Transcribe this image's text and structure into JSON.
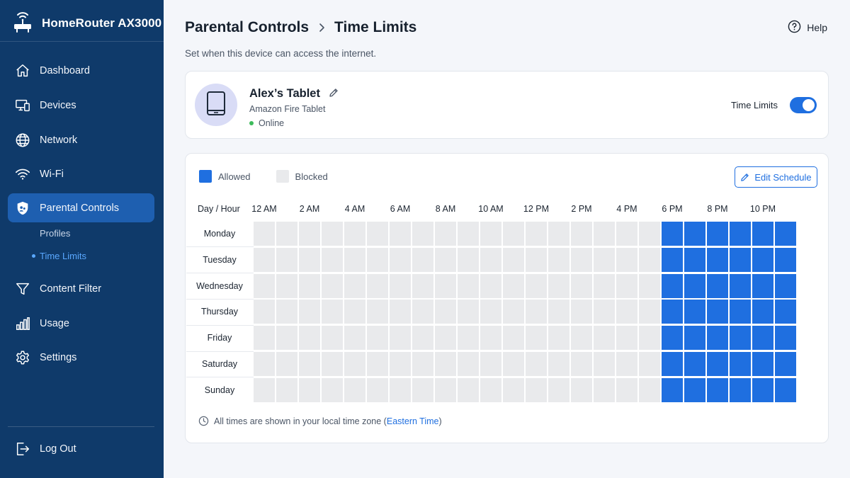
{
  "app": {
    "title": "HomeRouter AX3000",
    "logo_icon": "router-icon"
  },
  "sidebar": {
    "items": [
      {
        "label": "Dashboard",
        "icon": "home-icon"
      },
      {
        "label": "Devices",
        "icon": "devices-icon"
      },
      {
        "label": "Network",
        "icon": "globe-icon"
      },
      {
        "label": "Wi-Fi",
        "icon": "wifi-icon"
      },
      {
        "label": "Parental Controls",
        "icon": "shield-icon",
        "active": true
      },
      {
        "label": "Content Filter",
        "icon": "filter-icon"
      },
      {
        "label": "Usage",
        "icon": "bar-chart-icon"
      },
      {
        "label": "Settings",
        "icon": "gear-icon"
      }
    ],
    "sub_items": [
      {
        "label": "Profiles"
      },
      {
        "label": "Time Limits",
        "active": true
      }
    ],
    "logout": {
      "label": "Log Out",
      "icon": "logout-icon"
    }
  },
  "header": {
    "breadcrumb": [
      "Parental Controls",
      "Time Limits"
    ],
    "subtitle": "Set when this device can access the internet.",
    "help_label": "Help"
  },
  "device": {
    "name": "Alex’s Tablet",
    "model": "Amazon Fire Tablet",
    "status": "Online",
    "toggle_label": "Time Limits",
    "time_limits_enabled": true
  },
  "schedule": {
    "legend": {
      "allowed": "Allowed",
      "blocked": "Blocked"
    },
    "edit_label": "Edit Schedule",
    "corner_label": "Day / Hour",
    "hour_labels": [
      "12 AM",
      "2 AM",
      "4 AM",
      "6 AM",
      "8 AM",
      "10 AM",
      "12 PM",
      "2 PM",
      "4 PM",
      "6 PM",
      "8 PM",
      "10 PM"
    ],
    "days": [
      "Monday",
      "Tuesday",
      "Wednesday",
      "Thursday",
      "Friday",
      "Saturday",
      "Sunday"
    ],
    "allowed_hours": {
      "Monday": [
        18,
        19,
        20,
        21,
        22,
        23
      ],
      "Tuesday": [
        18,
        19,
        20,
        21,
        22,
        23
      ],
      "Wednesday": [
        18,
        19,
        20,
        21,
        22,
        23
      ],
      "Thursday": [
        18,
        19,
        20,
        21,
        22,
        23
      ],
      "Friday": [
        18,
        19,
        20,
        21,
        22,
        23
      ],
      "Saturday": [
        18,
        19,
        20,
        21,
        22,
        23
      ],
      "Sunday": [
        18,
        19,
        20,
        21,
        22,
        23
      ]
    },
    "timezone_note": "All times are shown in your local time zone (",
    "timezone_link": "Eastern Time",
    "timezone_close": ")"
  },
  "colors": {
    "sidebar_bg": "#0f3a6a",
    "accent": "#1f6fe0",
    "blocked": "#e9eaec",
    "online": "#3dbb5b"
  }
}
